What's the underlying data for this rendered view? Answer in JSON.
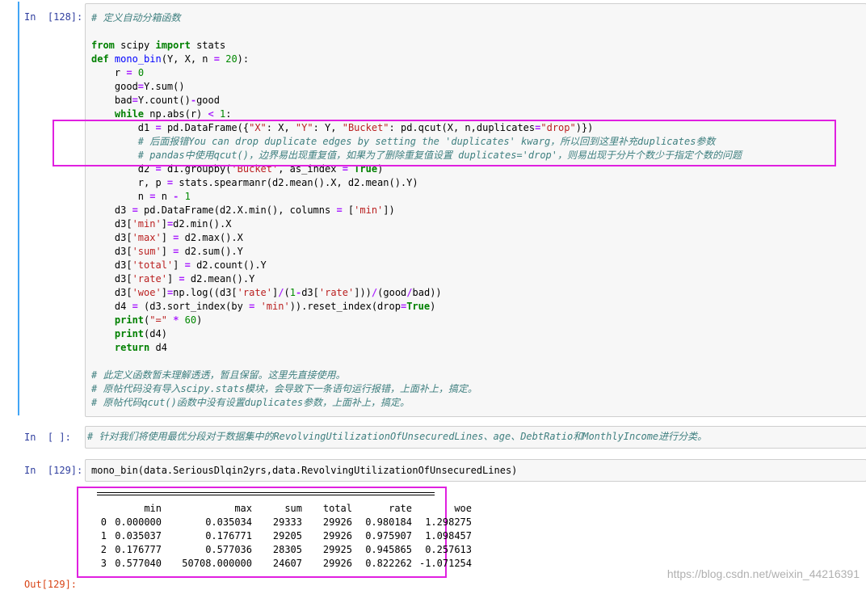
{
  "cell128": {
    "prompt": "In  [128]:",
    "lines": [
      [
        [
          "cm",
          "# 定义自动分箱函数"
        ]
      ],
      [],
      [
        [
          "kw",
          "from"
        ],
        [
          "t",
          " scipy "
        ],
        [
          "kw",
          "import"
        ],
        [
          "t",
          " stats"
        ]
      ],
      [
        [
          "kw",
          "def"
        ],
        [
          "t",
          " "
        ],
        [
          "fn",
          "mono_bin"
        ],
        [
          "t",
          "(Y, X, n "
        ],
        [
          "op",
          "="
        ],
        [
          "t",
          " "
        ],
        [
          "num",
          "20"
        ],
        [
          "t",
          "):"
        ]
      ],
      [
        [
          "t",
          "    r "
        ],
        [
          "op",
          "="
        ],
        [
          "t",
          " "
        ],
        [
          "num",
          "0"
        ]
      ],
      [
        [
          "t",
          "    good"
        ],
        [
          "op",
          "="
        ],
        [
          "t",
          "Y.sum()"
        ]
      ],
      [
        [
          "t",
          "    bad"
        ],
        [
          "op",
          "="
        ],
        [
          "t",
          "Y.count()"
        ],
        [
          "op",
          "-"
        ],
        [
          "t",
          "good"
        ]
      ],
      [
        [
          "t",
          "    "
        ],
        [
          "kw",
          "while"
        ],
        [
          "t",
          " np.abs(r) "
        ],
        [
          "op",
          "<"
        ],
        [
          "t",
          " "
        ],
        [
          "num",
          "1"
        ],
        [
          "t",
          ":"
        ]
      ],
      [
        [
          "t",
          "        d1 "
        ],
        [
          "op",
          "="
        ],
        [
          "t",
          " pd.DataFrame({"
        ],
        [
          "str",
          "\"X\""
        ],
        [
          "t",
          ": X, "
        ],
        [
          "str",
          "\"Y\""
        ],
        [
          "t",
          ": Y, "
        ],
        [
          "str",
          "\"Bucket\""
        ],
        [
          "t",
          ": pd.qcut(X, n,duplicates"
        ],
        [
          "op",
          "="
        ],
        [
          "str",
          "\"drop\""
        ],
        [
          "t",
          ")})"
        ]
      ],
      [
        [
          "t",
          "        "
        ],
        [
          "cm",
          "# 后面报错You can drop duplicate edges by setting the 'duplicates' kwarg，所以回到这里补充duplicates参数"
        ]
      ],
      [
        [
          "t",
          "        "
        ],
        [
          "cm",
          "# pandas中使用qcut()，边界易出现重复值，如果为了删除重复值设置 duplicates='drop'，则易出现于分片个数少于指定个数的问题"
        ]
      ],
      [
        [
          "t",
          "        d2 "
        ],
        [
          "op",
          "="
        ],
        [
          "t",
          " d1.groupby("
        ],
        [
          "str",
          "'Bucket'"
        ],
        [
          "t",
          ", as_index "
        ],
        [
          "op",
          "="
        ],
        [
          "t",
          " "
        ],
        [
          "kw",
          "True"
        ],
        [
          "t",
          ")"
        ]
      ],
      [
        [
          "t",
          "        r, p "
        ],
        [
          "op",
          "="
        ],
        [
          "t",
          " stats.spearmanr(d2.mean().X, d2.mean().Y)"
        ]
      ],
      [
        [
          "t",
          "        n "
        ],
        [
          "op",
          "="
        ],
        [
          "t",
          " n "
        ],
        [
          "op",
          "-"
        ],
        [
          "t",
          " "
        ],
        [
          "num",
          "1"
        ]
      ],
      [
        [
          "t",
          "    d3 "
        ],
        [
          "op",
          "="
        ],
        [
          "t",
          " pd.DataFrame(d2.X.min(), columns "
        ],
        [
          "op",
          "="
        ],
        [
          "t",
          " ["
        ],
        [
          "str",
          "'min'"
        ],
        [
          "t",
          "])"
        ]
      ],
      [
        [
          "t",
          "    d3["
        ],
        [
          "str",
          "'min'"
        ],
        [
          "t",
          "]"
        ],
        [
          "op",
          "="
        ],
        [
          "t",
          "d2.min().X"
        ]
      ],
      [
        [
          "t",
          "    d3["
        ],
        [
          "str",
          "'max'"
        ],
        [
          "t",
          "] "
        ],
        [
          "op",
          "="
        ],
        [
          "t",
          " d2.max().X"
        ]
      ],
      [
        [
          "t",
          "    d3["
        ],
        [
          "str",
          "'sum'"
        ],
        [
          "t",
          "] "
        ],
        [
          "op",
          "="
        ],
        [
          "t",
          " d2.sum().Y"
        ]
      ],
      [
        [
          "t",
          "    d3["
        ],
        [
          "str",
          "'total'"
        ],
        [
          "t",
          "] "
        ],
        [
          "op",
          "="
        ],
        [
          "t",
          " d2.count().Y"
        ]
      ],
      [
        [
          "t",
          "    d3["
        ],
        [
          "str",
          "'rate'"
        ],
        [
          "t",
          "] "
        ],
        [
          "op",
          "="
        ],
        [
          "t",
          " d2.mean().Y"
        ]
      ],
      [
        [
          "t",
          "    d3["
        ],
        [
          "str",
          "'woe'"
        ],
        [
          "t",
          "]"
        ],
        [
          "op",
          "="
        ],
        [
          "t",
          "np.log((d3["
        ],
        [
          "str",
          "'rate'"
        ],
        [
          "t",
          "]"
        ],
        [
          "op",
          "/"
        ],
        [
          "t",
          "("
        ],
        [
          "num",
          "1"
        ],
        [
          "op",
          "-"
        ],
        [
          "t",
          "d3["
        ],
        [
          "str",
          "'rate'"
        ],
        [
          "t",
          "]))"
        ],
        [
          "op",
          "/"
        ],
        [
          "t",
          "(good"
        ],
        [
          "op",
          "/"
        ],
        [
          "t",
          "bad))"
        ]
      ],
      [
        [
          "t",
          "    d4 "
        ],
        [
          "op",
          "="
        ],
        [
          "t",
          " (d3.sort_index(by "
        ],
        [
          "op",
          "="
        ],
        [
          "t",
          " "
        ],
        [
          "str",
          "'min'"
        ],
        [
          "t",
          ")).reset_index(drop"
        ],
        [
          "op",
          "="
        ],
        [
          "kw",
          "True"
        ],
        [
          "t",
          ")"
        ]
      ],
      [
        [
          "t",
          "    "
        ],
        [
          "kw",
          "print"
        ],
        [
          "t",
          "("
        ],
        [
          "str",
          "\"=\""
        ],
        [
          "t",
          " "
        ],
        [
          "op",
          "*"
        ],
        [
          "t",
          " "
        ],
        [
          "num",
          "60"
        ],
        [
          "t",
          ")"
        ]
      ],
      [
        [
          "t",
          "    "
        ],
        [
          "kw",
          "print"
        ],
        [
          "t",
          "(d4)"
        ]
      ],
      [
        [
          "t",
          "    "
        ],
        [
          "kw",
          "return"
        ],
        [
          "t",
          " d4"
        ]
      ],
      [],
      [
        [
          "cm",
          "# 此定义函数暂未理解透透，暂且保留。这里先直接使用。"
        ]
      ],
      [
        [
          "cm",
          "# 原帖代码没有导入scipy.stats模块，会导致下一条语句运行报错，上面补上，搞定。"
        ]
      ],
      [
        [
          "cm",
          "# 原帖代码qcut()函数中没有设置duplicates参数，上面补上，搞定。"
        ]
      ]
    ]
  },
  "cell_empty": {
    "prompt": "In  [ ]:",
    "comment": "# 针对我们将使用最优分段对于数据集中的RevolvingUtilizationOfUnsecuredLines、age、DebtRatio和MonthlyIncome进行分类。"
  },
  "cell129": {
    "prompt": "In  [129]:",
    "code": "mono_bin(data.SeriousDlqin2yrs,data.RevolvingUtilizationOfUnsecuredLines)"
  },
  "output": {
    "columns": [
      "",
      "min",
      "max",
      "sum",
      "total",
      "rate",
      "woe"
    ],
    "rows": [
      [
        "0",
        "0.000000",
        "0.035034",
        "29333",
        "29926",
        "0.980184",
        "1.298275"
      ],
      [
        "1",
        "0.035037",
        "0.176771",
        "29205",
        "29926",
        "0.975907",
        "1.098457"
      ],
      [
        "2",
        "0.176777",
        "0.577036",
        "28305",
        "29925",
        "0.945865",
        "0.257613"
      ],
      [
        "3",
        "0.577040",
        "50708.000000",
        "24607",
        "29926",
        "0.822262",
        "-1.071254"
      ]
    ]
  },
  "next_prompt": "Out[129]:",
  "watermark": "https://blog.csdn.net/weixin_44216391",
  "colors": {
    "highlight": "#e020e0",
    "prompt": "#303f9f",
    "selected_bar": "#42a5f5"
  }
}
